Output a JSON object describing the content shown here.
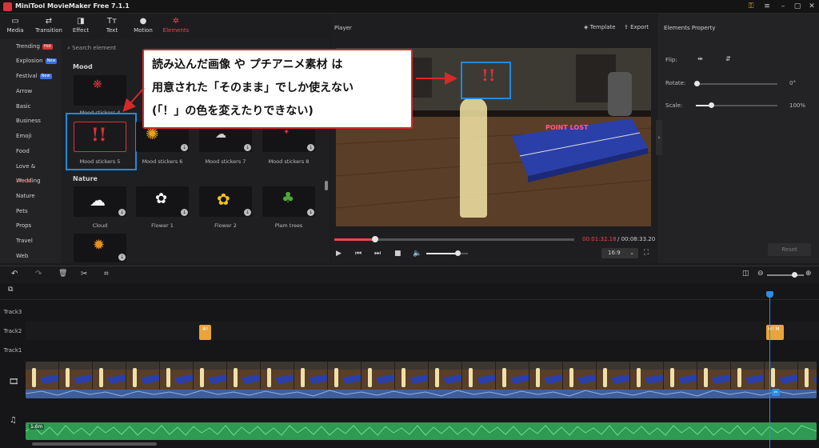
{
  "app": {
    "title": "MiniTool MovieMaker Free 7.1.1",
    "accent": "#e8484e"
  },
  "toolbar": {
    "tabs": [
      {
        "label": "Media",
        "icon": "media-icon"
      },
      {
        "label": "Transition",
        "icon": "transition-icon"
      },
      {
        "label": "Effect",
        "icon": "effect-icon"
      },
      {
        "label": "Text",
        "icon": "text-icon"
      },
      {
        "label": "Motion",
        "icon": "motion-icon"
      },
      {
        "label": "Elements",
        "icon": "elements-icon",
        "active": true
      }
    ]
  },
  "categories": [
    {
      "label": "Trending",
      "badge": "Hot"
    },
    {
      "label": "Explosion",
      "badge": "New"
    },
    {
      "label": "Festival",
      "badge": "New"
    },
    {
      "label": "Arrow"
    },
    {
      "label": "Basic"
    },
    {
      "label": "Business"
    },
    {
      "label": "Emoji"
    },
    {
      "label": "Food"
    },
    {
      "label": "Love & Wedding"
    },
    {
      "label": "Mood",
      "active": true
    },
    {
      "label": "Nature"
    },
    {
      "label": "Pets"
    },
    {
      "label": "Props"
    },
    {
      "label": "Travel"
    },
    {
      "label": "Web"
    }
  ],
  "search": {
    "placeholder": "Search element"
  },
  "sections": {
    "mood": "Mood",
    "nature": "Nature"
  },
  "mood_items": [
    {
      "label": "Mood stickers 4"
    },
    {
      "label": "M"
    },
    {
      "label": ""
    },
    {
      "label": ""
    },
    {
      "label": "Mood stickers 5"
    },
    {
      "label": "Mood stickers 6"
    },
    {
      "label": "Mood stickers 7"
    },
    {
      "label": "Mood stickers 8"
    }
  ],
  "nature_items": [
    {
      "label": "Cloud"
    },
    {
      "label": "Flower 1"
    },
    {
      "label": "Flower 2"
    },
    {
      "label": "Plam trees"
    },
    {
      "label": ""
    }
  ],
  "player": {
    "title": "Player",
    "template_label": "Template",
    "export_label": "Export",
    "current_time": "00:01:32.18",
    "total_time": "/ 00:08:33.20",
    "aspect": "16:9",
    "progress": 0.17,
    "volume": 0.77,
    "scene_sign": "POINT LOST"
  },
  "properties": {
    "title": "Elements Property",
    "flip_label": "Flip:",
    "rotate_label": "Rotate:",
    "rotate_value": "0°",
    "rotate_level": 0.0,
    "scale_label": "Scale:",
    "scale_value": "100%",
    "scale_level": 0.2,
    "reset_label": "Reset"
  },
  "timeline": {
    "tracks": [
      "Track3",
      "Track2",
      "Track1"
    ],
    "zoom_level": 0.75,
    "clip_badge": "1.6m",
    "track2_end_label": "M"
  },
  "annotation": {
    "lines": [
      "読み込んだ画像 や プチアニメ素材 は",
      "用意された「そのまま」でしか使えない",
      "(「！」の色を変えたりできない)"
    ],
    "color": "#d42a2a"
  }
}
